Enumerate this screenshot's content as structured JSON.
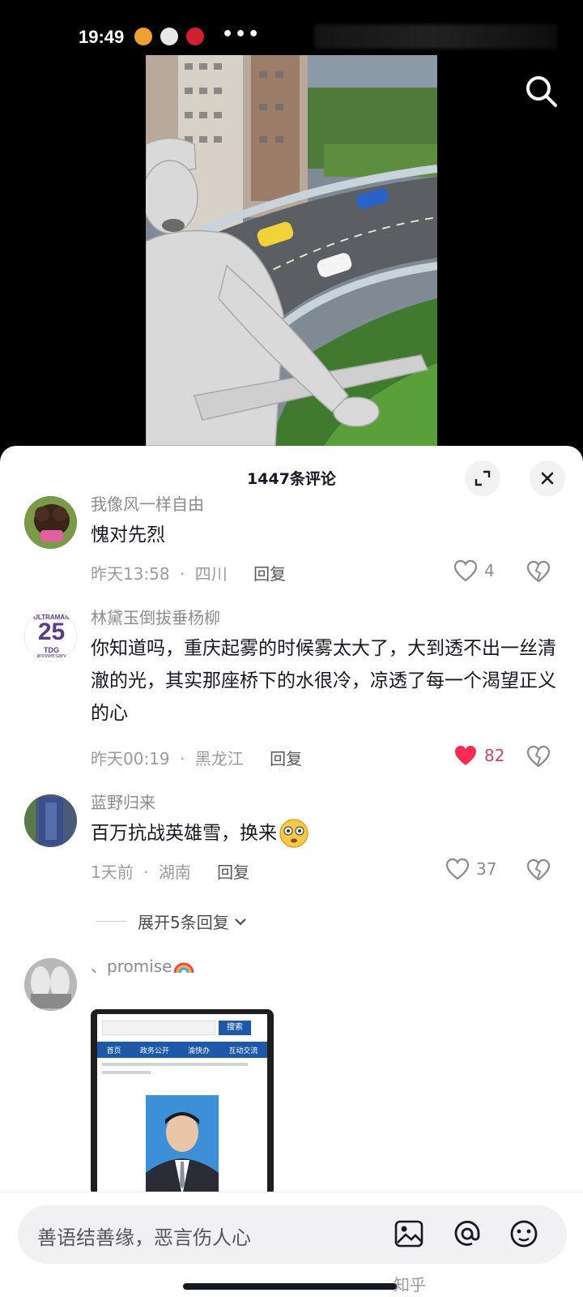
{
  "status_bar": {
    "time": "19:49",
    "more": "•••"
  },
  "comments_header": {
    "count_label": "1447条评论"
  },
  "comments": [
    {
      "user": "我像风一样自由",
      "text": "愧对先烈",
      "time": "昨天13:58",
      "location": "四川",
      "reply": "回复",
      "likes": "4",
      "liked": false
    },
    {
      "user": "林黛玉倒拔垂杨柳",
      "text": "你知道吗，重庆起雾的时候雾太大了，大到透不出一丝清澈的光，其实那座桥下的水很冷，凉透了每一个渴望正义的心",
      "time": "昨天00:19",
      "location": "黑龙江",
      "reply": "回复",
      "likes": "82",
      "liked": true
    },
    {
      "user": "蓝野归来",
      "text": "百万抗战英雄雪，换来",
      "time": "1天前",
      "location": "湖南",
      "reply": "回复",
      "likes": "37",
      "liked": false
    },
    {
      "user": "、promise"
    }
  ],
  "expand_replies": "展开5条回复",
  "separator": "·",
  "avatar_badge": {
    "line1": "ULTRAMAN",
    "number": "25",
    "line3": "TDG",
    "line4": "anniversary"
  },
  "image_comment": {
    "search_btn": "搜索",
    "nav": [
      "首页",
      "政务公开",
      "渝快办",
      "互动交流"
    ]
  },
  "input": {
    "placeholder": "善语结善缘，恶言伤人心"
  },
  "watermark": "知乎",
  "colors": {
    "liked_red": "#fe2c55",
    "sheet_bg": "#ffffff",
    "muted_text": "#8a8b91"
  }
}
